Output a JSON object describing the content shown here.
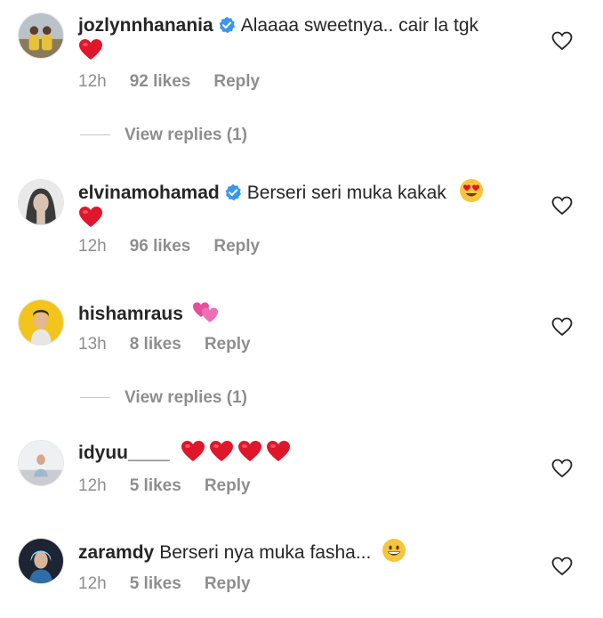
{
  "comments": [
    {
      "username": "jozlynnhanania",
      "verified": true,
      "text": "Alaaaa sweetnya.. cair la tgk",
      "emoji_line2": [
        "red-heart"
      ],
      "time": "12h",
      "likes": "92 likes",
      "reply": "Reply",
      "view_replies": "View replies (1)"
    },
    {
      "username": "elvinamohamad",
      "verified": true,
      "text": "Berseri seri muka kakak",
      "emoji_inline": [
        "heart-eyes"
      ],
      "emoji_line2": [
        "red-heart"
      ],
      "time": "12h",
      "likes": "96 likes",
      "reply": "Reply"
    },
    {
      "username": "hishamraus",
      "verified": false,
      "text": "",
      "emoji_inline": [
        "two-hearts"
      ],
      "time": "13h",
      "likes": "8 likes",
      "reply": "Reply",
      "view_replies": "View replies (1)"
    },
    {
      "username": "idyuu____",
      "verified": false,
      "text": "",
      "emoji_inline": [
        "red-heart",
        "red-heart",
        "red-heart",
        "red-heart"
      ],
      "time": "12h",
      "likes": "5 likes",
      "reply": "Reply"
    },
    {
      "username": "zaramdy",
      "verified": false,
      "text": "Berseri nya muka fasha...",
      "emoji_inline": [
        "grinning-face"
      ],
      "time": "12h",
      "likes": "5 likes",
      "reply": "Reply"
    }
  ],
  "colors": {
    "text": "#262626",
    "muted": "#8e8e8e",
    "verified_blue": "#3897f0",
    "heart_red": "#e0162b"
  }
}
